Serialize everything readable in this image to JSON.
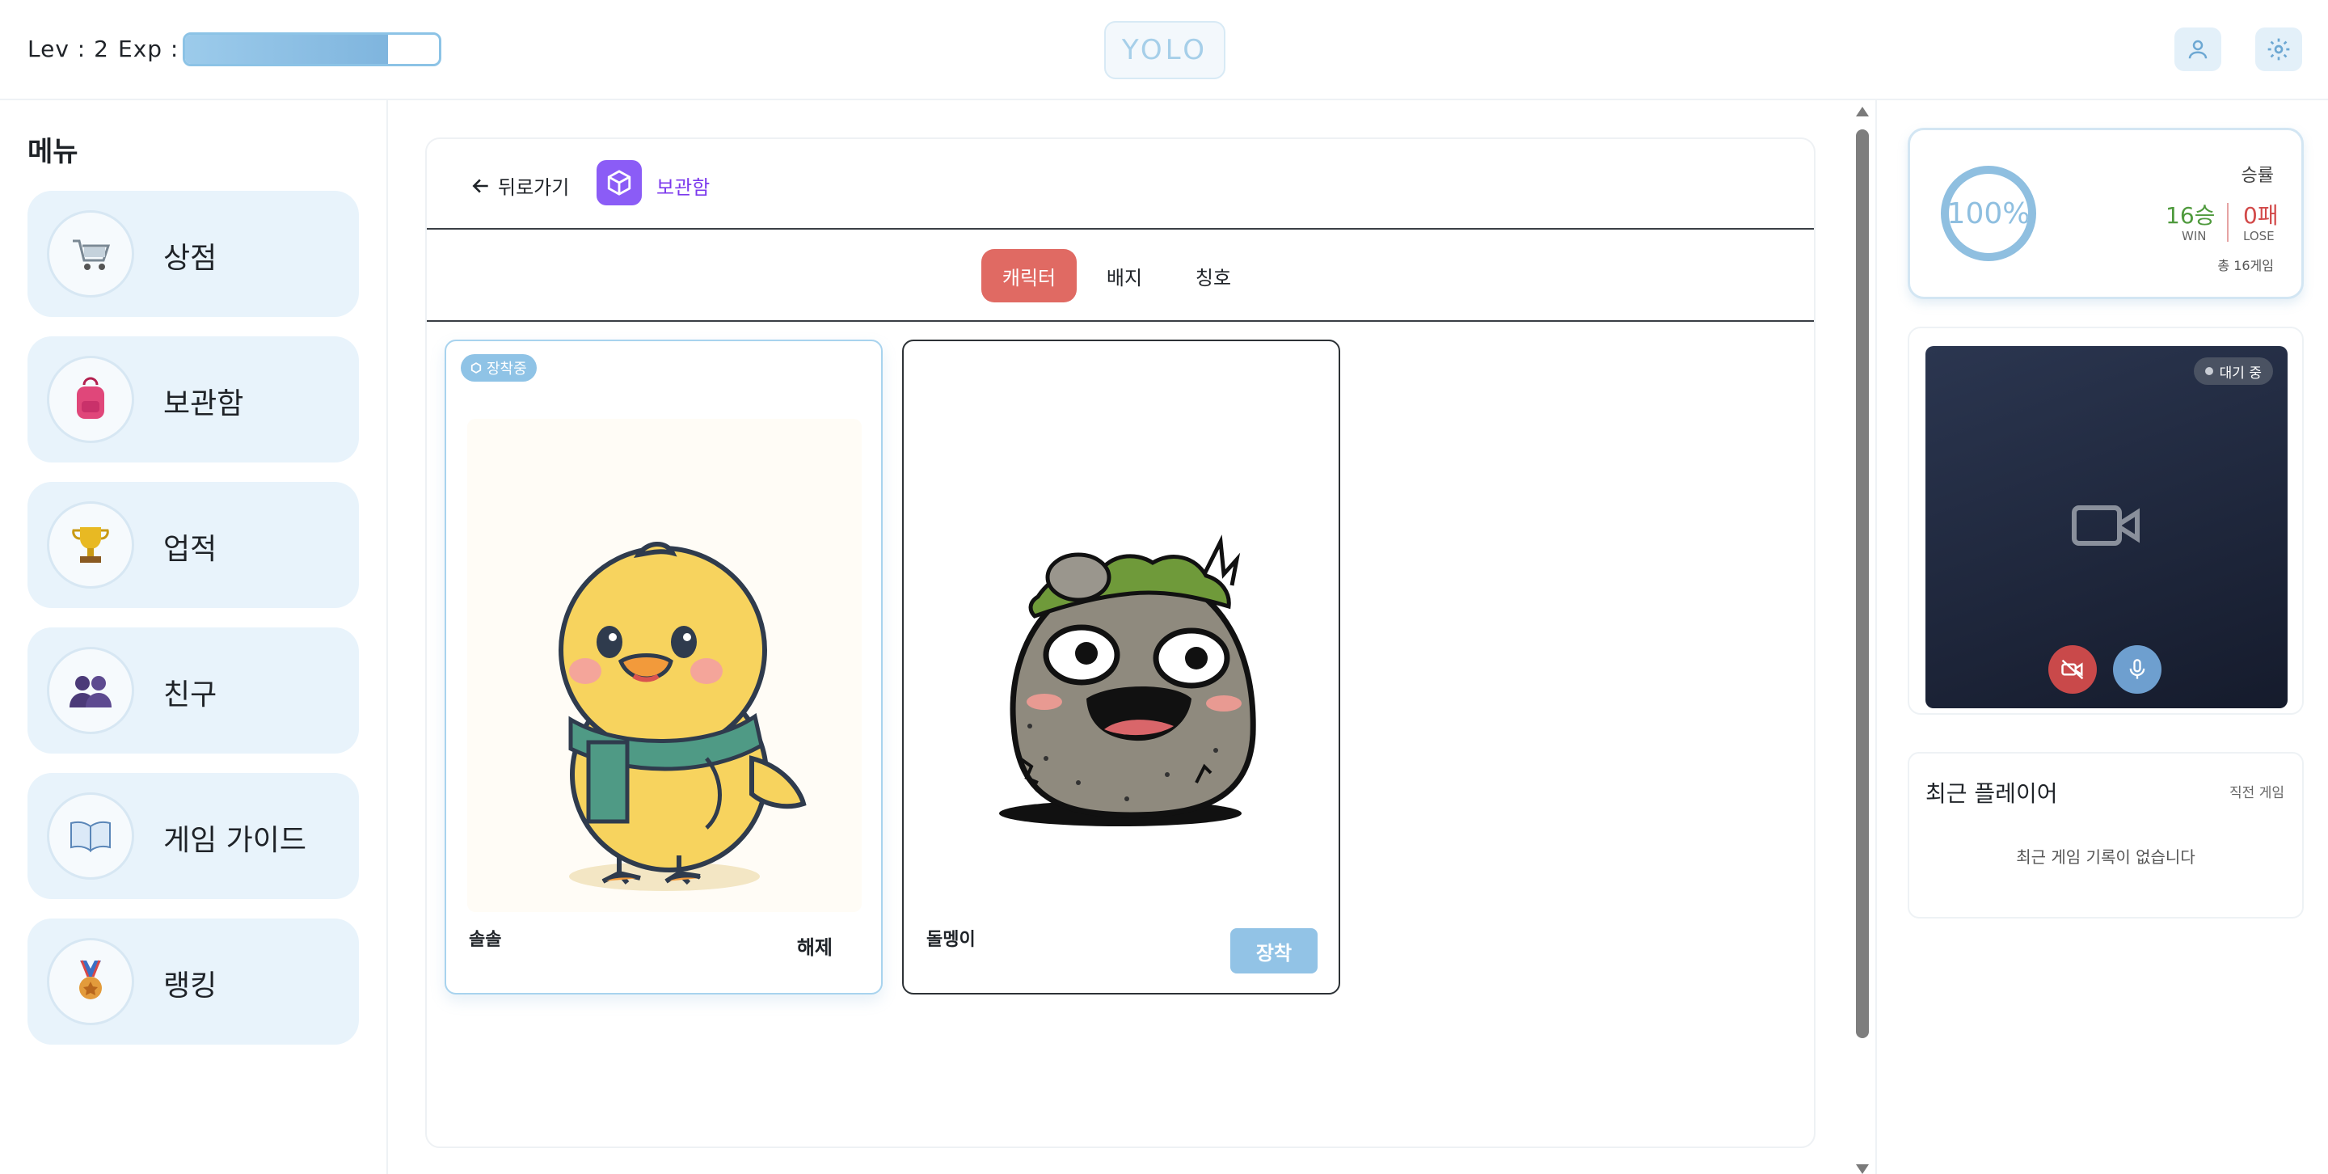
{
  "header": {
    "level_text": "Lev : 2",
    "exp_label": "Exp :",
    "exp_fraction": 0.8,
    "logo": "YOLO",
    "user_icon": "user-icon",
    "settings_icon": "gear-icon"
  },
  "sidebar": {
    "title": "메뉴",
    "items": [
      {
        "label": "상점",
        "icon": "shopping-cart-icon"
      },
      {
        "label": "보관함",
        "icon": "backpack-icon"
      },
      {
        "label": "업적",
        "icon": "trophy-icon"
      },
      {
        "label": "친구",
        "icon": "friends-icon"
      },
      {
        "label": "게임 가이드",
        "icon": "book-icon"
      },
      {
        "label": "랭킹",
        "icon": "medal-icon"
      }
    ]
  },
  "main": {
    "back_label": "뒤로가기",
    "section_label": "보관함",
    "tabs": [
      {
        "label": "캐릭터",
        "active": true
      },
      {
        "label": "배지",
        "active": false
      },
      {
        "label": "칭호",
        "active": false
      }
    ],
    "cards": [
      {
        "name": "솔솔",
        "badge": "장착중",
        "action": "해제",
        "equipped": true
      },
      {
        "name": "돌멩이",
        "badge": "",
        "action": "장착",
        "equipped": false
      }
    ]
  },
  "stats": {
    "title": "승률",
    "rate": "100%",
    "wins": "16승",
    "win_label": "WIN",
    "losses": "0패",
    "lose_label": "LOSE",
    "total": "총 16게임"
  },
  "video": {
    "status": "대기 중"
  },
  "recent": {
    "title": "최근 플레이어",
    "subtitle": "직전 게임",
    "empty": "최근 게임 기록이 없습니다"
  },
  "colors": {
    "accent_blue": "#8fc3e6",
    "tab_active": "#e06a63",
    "purple": "#8b5cf6",
    "win_green": "#4f9a3d",
    "lose_red": "#d24a4a"
  }
}
